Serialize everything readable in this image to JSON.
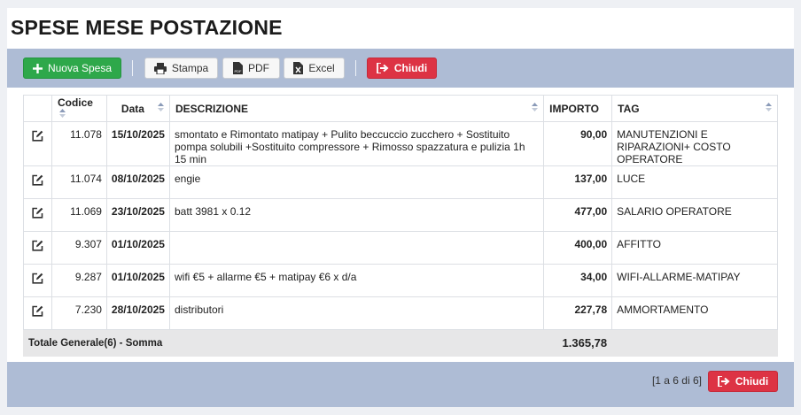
{
  "page": {
    "title": "SPESE MESE POSTAZIONE"
  },
  "toolbar": {
    "new_label": "Nuova Spesa",
    "print_label": "Stampa",
    "pdf_label": "PDF",
    "excel_label": "Excel",
    "close_label": "Chiudi"
  },
  "table": {
    "columns": {
      "code": "Codice",
      "date": "Data",
      "desc": "DESCRIZIONE",
      "amount": "IMPORTO",
      "tag": "TAG"
    },
    "rows": [
      {
        "code": "11.078",
        "date": "15/10/2025",
        "desc": "smontato e Rimontato matipay + Pulito beccuccio zucchero + Sostituito pompa solubili +Sostituito compressore + Rimosso spazzatura e pulizia 1h 15 min",
        "amount": "90,00",
        "tag": "MANUTENZIONI E RIPARAZIONI+ COSTO OPERATORE"
      },
      {
        "code": "11.074",
        "date": "08/10/2025",
        "desc": "engie",
        "amount": "137,00",
        "tag": "LUCE"
      },
      {
        "code": "11.069",
        "date": "23/10/2025",
        "desc": "batt 3981 x 0.12",
        "amount": "477,00",
        "tag": "SALARIO OPERATORE"
      },
      {
        "code": "9.307",
        "date": "01/10/2025",
        "desc": "",
        "amount": "400,00",
        "tag": "AFFITTO"
      },
      {
        "code": "9.287",
        "date": "01/10/2025",
        "desc": "wifi €5 + allarme €5 + matipay €6 x d/a",
        "amount": "34,00",
        "tag": "WIFI-ALLARME-MATIPAY"
      },
      {
        "code": "7.230",
        "date": "28/10/2025",
        "desc": "distributori",
        "amount": "227,78",
        "tag": "AMMORTAMENTO"
      }
    ],
    "total_label": "Totale Generale(6) - Somma",
    "total_value": "1.365,78"
  },
  "footer": {
    "pagination": "[1 a 6 di 6]",
    "close_label": "Chiudi"
  },
  "colors": {
    "accent_green": "#2ea84a",
    "danger_red": "#dd3344",
    "toolbar_bg": "#aebcd5"
  },
  "icons": {
    "new": "plus-icon",
    "print": "printer-icon",
    "pdf": "pdf-file-icon",
    "excel": "excel-file-icon",
    "close": "sign-out-icon",
    "edit": "edit-icon",
    "sort": "sort-icon"
  }
}
